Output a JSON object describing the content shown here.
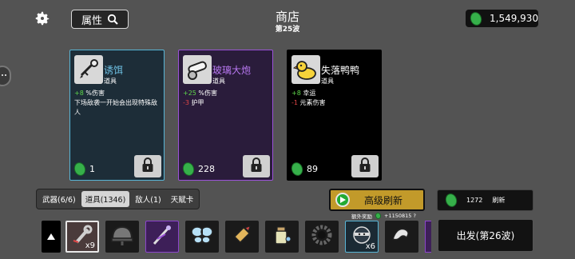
{
  "header": {
    "title": "商店",
    "subtitle": "第25波",
    "search_label": "属性",
    "money": "1,549,930"
  },
  "shop_cards": [
    {
      "name": "诱饵",
      "type": "道具",
      "rarity_color": "#58b5d6",
      "stats": [
        {
          "value": "+8",
          "text": " %伤害",
          "sign": "pos"
        },
        {
          "value": "",
          "text": "下场敌袭一开始会出现特殊敌人",
          "sign": "plain"
        }
      ],
      "price": "1",
      "icon": "bait-icon"
    },
    {
      "name": "玻璃大炮",
      "type": "道具",
      "rarity_color": "#9b52d8",
      "stats": [
        {
          "value": "+25",
          "text": " %伤害",
          "sign": "pos"
        },
        {
          "value": "-3",
          "text": " 护甲",
          "sign": "neg"
        }
      ],
      "price": "228",
      "icon": "glass-cannon-icon"
    },
    {
      "name": "失落鸭鸭",
      "type": "道具",
      "rarity_color": "#000000",
      "stats": [
        {
          "value": "+8",
          "text": " 幸运",
          "sign": "pos"
        },
        {
          "value": "-1",
          "text": " 元素伤害",
          "sign": "neg"
        }
      ],
      "price": "89",
      "icon": "rubber-duck-icon"
    }
  ],
  "tabs": [
    {
      "label": "武器(6/6)",
      "active": false
    },
    {
      "label": "道具(1346)",
      "active": true
    },
    {
      "label": "敌人(1)",
      "active": false
    },
    {
      "label": "天赋卡",
      "active": false
    }
  ],
  "actions": {
    "advanced_refresh": "高级刷新",
    "bonus_label": "额外奖励",
    "bonus_value": "+1150815 ?",
    "refresh_cost": "1272",
    "refresh_label": "刷新",
    "depart_label": "出发(第26波)"
  },
  "inventory": [
    {
      "icon": "wrench-icon",
      "count": "x9",
      "style": "white"
    },
    {
      "icon": "helmet-icon",
      "count": "",
      "style": "grey"
    },
    {
      "icon": "magic-wand-icon",
      "count": "",
      "style": "purple"
    },
    {
      "icon": "butterfly-icon",
      "count": "",
      "style": "grey"
    },
    {
      "icon": "bullet-icon",
      "count": "",
      "style": "grey"
    },
    {
      "icon": "potion-icon",
      "count": "",
      "style": "grey"
    },
    {
      "icon": "gear-ring-icon",
      "count": "",
      "style": "grey"
    },
    {
      "icon": "ninja-icon",
      "count": "x6",
      "style": "blue"
    },
    {
      "icon": "wave-icon",
      "count": "",
      "style": "grey"
    }
  ],
  "colors": {
    "background": "#535353",
    "gem": "#36b04a",
    "gold_button": "#c29a2a"
  }
}
